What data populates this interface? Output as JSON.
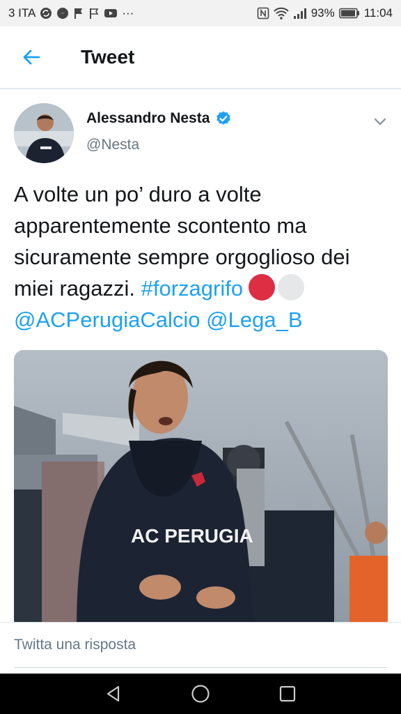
{
  "status_bar": {
    "carrier": "3 ITA",
    "notification_icons": [
      "sync-icon",
      "messenger-icon",
      "flag-icon",
      "flag-outline-icon",
      "video-icon"
    ],
    "more": "···",
    "battery": "93%",
    "time": "11:04"
  },
  "header": {
    "title": "Tweet"
  },
  "tweet": {
    "author_name": "Alessandro Nesta",
    "handle": "@Nesta",
    "text_plain": "A volte un po’ duro a volte apparentemente scontento ma sicuramente sempre orgoglioso dei miei ragazzi. ",
    "hashtag": "#forzagrifo",
    "mention_1": "@ACPerugiaCalcio",
    "mention_2": "@Lega_B",
    "emojis": [
      "red-circle",
      "white-circle"
    ],
    "media": {
      "shirt_text": "AC PERUGIA"
    }
  },
  "reply": {
    "placeholder": "Twitta una risposta"
  },
  "colors": {
    "link": "#1da1f2",
    "verified": "#1da1f2",
    "status_bar_bg": "#f2f2f2",
    "nav_bar_bg": "#000000"
  }
}
